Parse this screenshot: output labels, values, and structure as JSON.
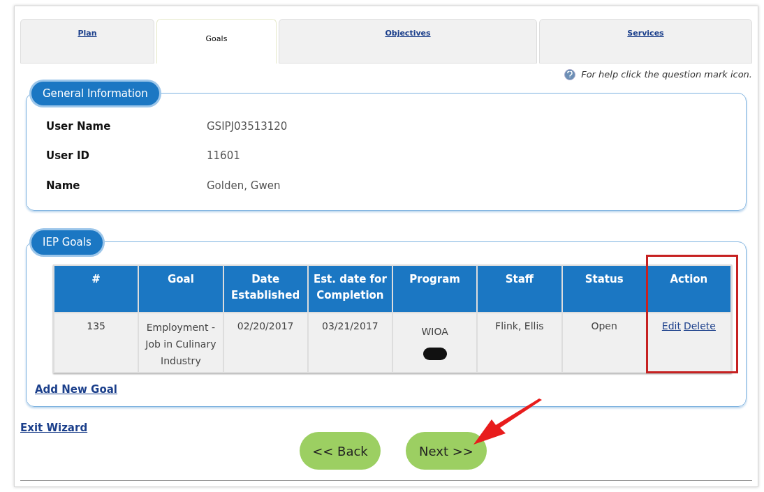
{
  "tabs": [
    {
      "label": "Plan",
      "selected": false
    },
    {
      "label": "Goals",
      "selected": true
    },
    {
      "label": "Objectives",
      "selected": false
    },
    {
      "label": "Services",
      "selected": false
    }
  ],
  "help_text": "For help click the question mark icon.",
  "general_information": {
    "title": "General Information",
    "fields": [
      {
        "label": "User Name",
        "value": "GSIPJ03513120"
      },
      {
        "label": "User ID",
        "value": "11601"
      },
      {
        "label": "Name",
        "value": "Golden, Gwen"
      }
    ]
  },
  "iep_goals": {
    "title": "IEP Goals",
    "columns": [
      "#",
      "Goal",
      "Date Established",
      "Est. date for Completion",
      "Program",
      "Staff",
      "Status",
      "Action"
    ],
    "rows": [
      {
        "number": "135",
        "goal": "Employment - Job in Culinary Industry",
        "date_established": "02/20/2017",
        "est_completion": "03/21/2017",
        "program": "WIOA",
        "staff": "Flink, Ellis",
        "status": "Open",
        "actions": [
          "Edit",
          "Delete"
        ]
      }
    ],
    "add_link": "Add New Goal"
  },
  "exit_link": "Exit Wizard",
  "buttons": [
    "<< Back",
    "Next >>"
  ]
}
